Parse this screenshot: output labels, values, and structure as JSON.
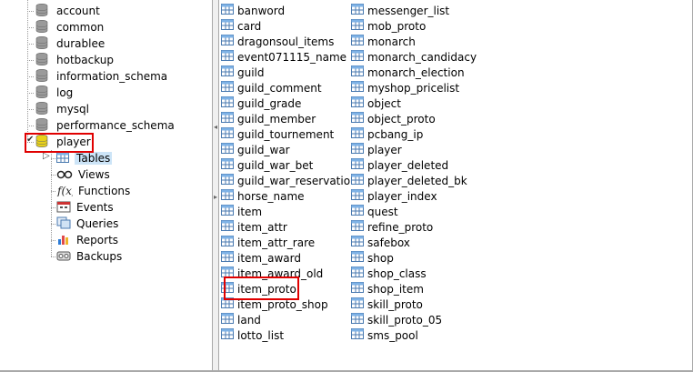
{
  "databases": [
    "account",
    "common",
    "durablee",
    "hotbackup",
    "information_schema",
    "log",
    "mysql",
    "performance_schema",
    "player"
  ],
  "player_children": [
    "Tables",
    "Views",
    "Functions",
    "Events",
    "Queries",
    "Reports",
    "Backups"
  ],
  "tables_col1": [
    "banword",
    "card",
    "dragonsoul_items",
    "event071115_name",
    "guild",
    "guild_comment",
    "guild_grade",
    "guild_member",
    "guild_tournement",
    "guild_war",
    "guild_war_bet",
    "guild_war_reservation",
    "horse_name",
    "item",
    "item_attr",
    "item_attr_rare",
    "item_award",
    "item_award_old",
    "item_proto",
    "item_proto_shop",
    "land",
    "lotto_list"
  ],
  "tables_col2": [
    "messenger_list",
    "mob_proto",
    "monarch",
    "monarch_candidacy",
    "monarch_election",
    "myshop_pricelist",
    "object",
    "object_proto",
    "pcbang_ip",
    "player",
    "player_deleted",
    "player_deleted_bk",
    "player_index",
    "quest",
    "refine_proto",
    "safebox",
    "shop",
    "shop_class",
    "shop_item",
    "skill_proto",
    "skill_proto_05",
    "sms_pool"
  ],
  "colors": {
    "highlight": "#e00000",
    "selection": "#cce4f7",
    "db_icon": "#9a9a9a",
    "db_selected": "#e8d21a"
  }
}
